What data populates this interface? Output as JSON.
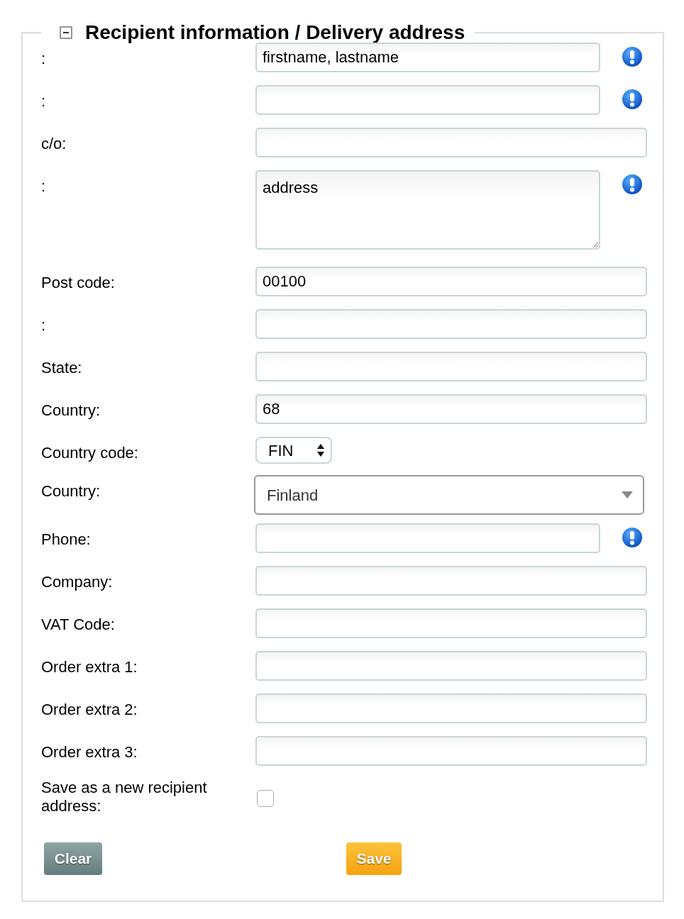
{
  "section": {
    "title": "Recipient information / Delivery address",
    "expanded": true
  },
  "rows": [
    {
      "kind": "text",
      "label": ":",
      "value": "firstname, lastname",
      "required": true
    },
    {
      "kind": "text",
      "label": ":",
      "required": true
    },
    {
      "kind": "text",
      "label": "c/o:",
      "required": false
    },
    {
      "kind": "textarea",
      "label": ":",
      "value": "address",
      "required": true
    },
    {
      "kind": "text",
      "label": "Post code:",
      "value": "00100",
      "required": false
    },
    {
      "kind": "text",
      "label": ":",
      "required": false
    },
    {
      "kind": "text",
      "label": "State:",
      "required": false
    },
    {
      "kind": "text",
      "label": "Country:",
      "value": "68",
      "required": false
    },
    {
      "kind": "stepper",
      "label": "Country code:",
      "value": "FIN",
      "required": false
    },
    {
      "kind": "select",
      "label": "Country:",
      "value": "Finland",
      "required": false
    },
    {
      "kind": "text",
      "label": "Phone:",
      "required": true
    },
    {
      "kind": "text",
      "label": "Company:",
      "required": false
    },
    {
      "kind": "text",
      "label": "VAT Code:",
      "required": false
    },
    {
      "kind": "text",
      "label": "Order extra 1:",
      "required": false
    },
    {
      "kind": "text",
      "label": "Order extra 2:",
      "required": false
    },
    {
      "kind": "text",
      "label": "Order extra 3:",
      "required": false
    },
    {
      "kind": "checkbox",
      "label": "Save as a new recipient address:",
      "checked": false
    }
  ],
  "buttons": [
    {
      "label": "Clear",
      "kind": "secondary"
    },
    {
      "label": "Save",
      "kind": "primary"
    }
  ]
}
